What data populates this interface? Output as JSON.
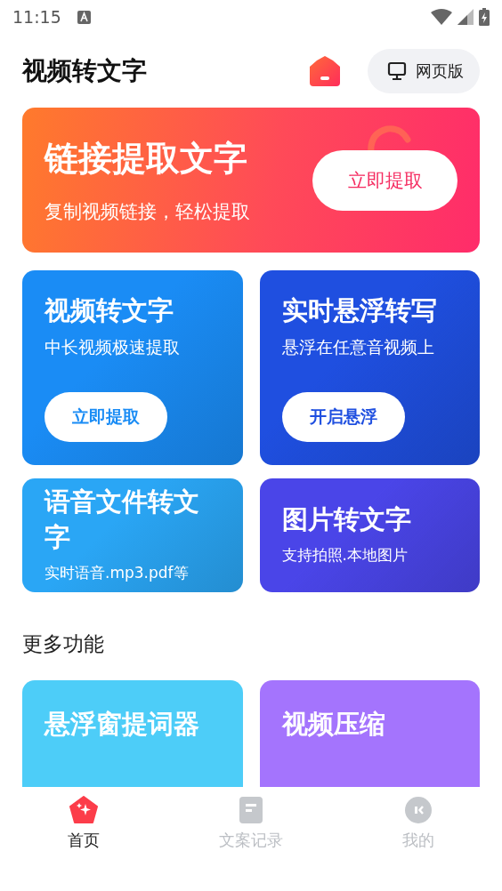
{
  "status_bar": {
    "time": "11:15"
  },
  "header": {
    "title": "视频转文字",
    "web_button": "网页版"
  },
  "hero": {
    "title": "链接提取文字",
    "subtitle": "复制视频链接，轻松提取",
    "button": "立即提取"
  },
  "cards": [
    {
      "kind": "big",
      "title": "视频转文字",
      "subtitle": "中长视频极速提取",
      "button": "立即提取",
      "color": "#1a8cf5"
    },
    {
      "kind": "big",
      "title": "实时悬浮转写",
      "subtitle": "悬浮在任意音视频上",
      "button": "开启悬浮",
      "color": "#1f4fe0"
    },
    {
      "kind": "small",
      "title": "语音文件转文字",
      "subtitle": "实时语音.mp3.pdf等",
      "color": "#2aa6f5"
    },
    {
      "kind": "small",
      "title": "图片转文字",
      "subtitle": "支持拍照.本地图片",
      "color": "#4a45e8"
    }
  ],
  "more": {
    "heading": "更多功能",
    "cards": [
      {
        "title": "悬浮窗提词器",
        "color": "#4dcdf8"
      },
      {
        "title": "视频压缩",
        "color": "#a474fd"
      }
    ]
  },
  "nav": [
    {
      "label": "首页",
      "selected": true
    },
    {
      "label": "文案记录",
      "selected": false
    },
    {
      "label": "我的",
      "selected": false
    }
  ]
}
